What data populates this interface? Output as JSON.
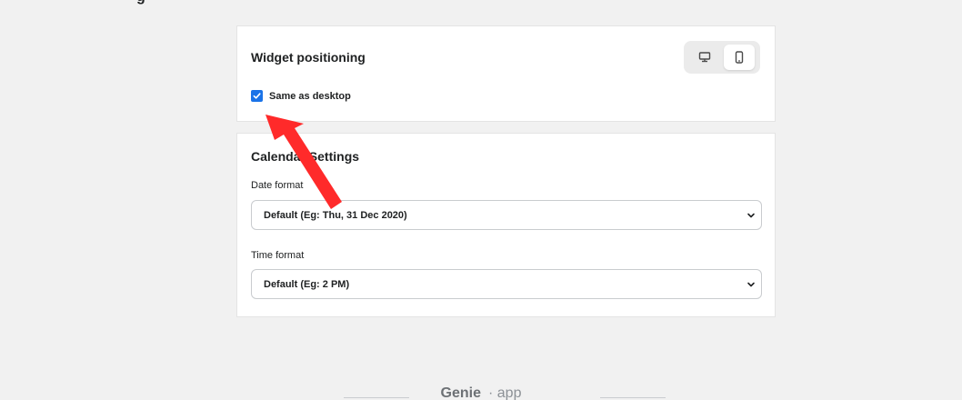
{
  "page": {
    "heading_partial": "g"
  },
  "widget_positioning": {
    "title": "Widget positioning",
    "devices": [
      {
        "name": "desktop",
        "icon": "desktop-icon",
        "active": false
      },
      {
        "name": "mobile",
        "icon": "mobile-icon",
        "active": true
      }
    ],
    "same_as_desktop": {
      "label": "Same as desktop",
      "checked": true
    }
  },
  "calendar_settings": {
    "title": "Calendar Settings",
    "date_format": {
      "label": "Date format",
      "value": "Default (Eg: Thu, 31 Dec 2020)"
    },
    "time_format": {
      "label": "Time format",
      "value": "Default (Eg: 2 PM)"
    }
  },
  "footer": {
    "brand": "Genie",
    "suffix": "· app"
  },
  "colors": {
    "accent": "#1a73e8",
    "annotation_arrow": "#ff2a2a",
    "background": "#f1f1f1"
  }
}
